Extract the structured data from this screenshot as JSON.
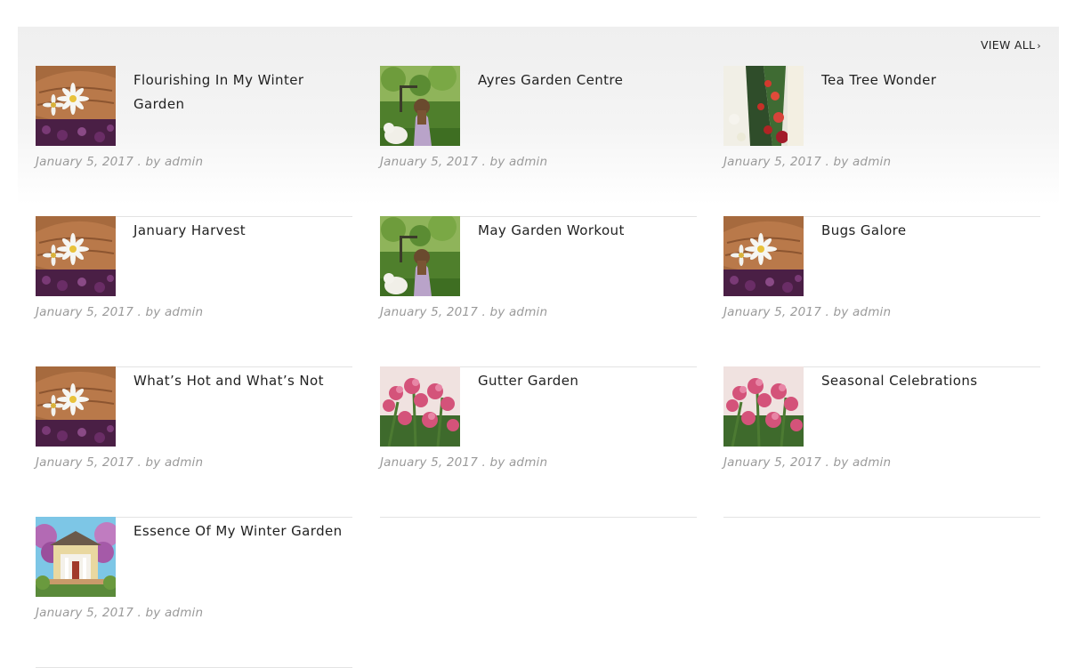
{
  "widget": {
    "view_all_label": "VIEW ALL",
    "chevron_icon": "chevron-right-icon",
    "accent_text": "#222222",
    "meta_color": "#9a9a9a",
    "divider_color": "#e3e3e3"
  },
  "posts": [
    {
      "title": "Flourishing In My Winter Garden",
      "date": "January 5, 2017",
      "by": "by",
      "author": "admin",
      "thumb": "daisies"
    },
    {
      "title": "Ayres Garden Centre",
      "date": "January 5, 2017",
      "by": "by",
      "author": "admin",
      "thumb": "girl-dog"
    },
    {
      "title": "Tea Tree Wonder",
      "date": "January 5, 2017",
      "by": "by",
      "author": "admin",
      "thumb": "red-flowers"
    },
    {
      "title": "January Harvest",
      "date": "January 5, 2017",
      "by": "by",
      "author": "admin",
      "thumb": "daisies"
    },
    {
      "title": "May Garden Workout",
      "date": "January 5, 2017",
      "by": "by",
      "author": "admin",
      "thumb": "girl-dog"
    },
    {
      "title": "Bugs Galore",
      "date": "January 5, 2017",
      "by": "by",
      "author": "admin",
      "thumb": "daisies"
    },
    {
      "title": "What’s Hot and What’s Not",
      "date": "January 5, 2017",
      "by": "by",
      "author": "admin",
      "thumb": "daisies"
    },
    {
      "title": "Gutter Garden",
      "date": "January 5, 2017",
      "by": "by",
      "author": "admin",
      "thumb": "pink-blossoms"
    },
    {
      "title": "Seasonal Celebrations",
      "date": "January 5, 2017",
      "by": "by",
      "author": "admin",
      "thumb": "pink-blossoms"
    },
    {
      "title": "Essence Of My Winter Garden",
      "date": "January 5, 2017",
      "by": "by",
      "author": "admin",
      "thumb": "house"
    }
  ]
}
